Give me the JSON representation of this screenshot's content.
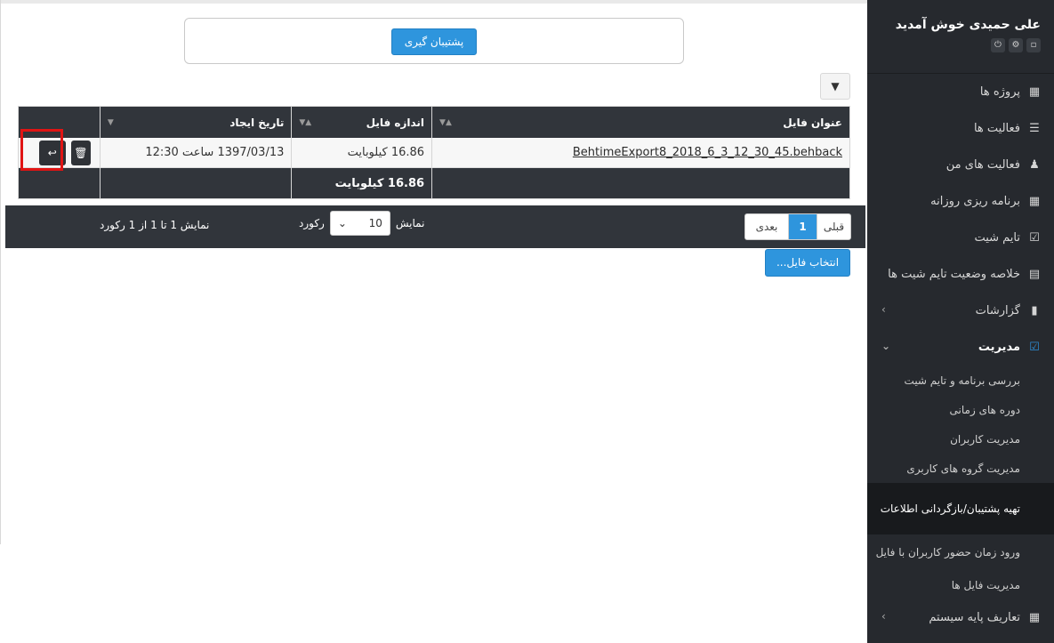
{
  "sidebar": {
    "user": "علی حمیدی خوش آمدید",
    "user_icons": [
      "lock-icon",
      "gear-icon",
      "power-icon"
    ],
    "items": [
      {
        "label": "پروژه ها",
        "icon": "cubes-icon"
      },
      {
        "label": "فعالیت ها",
        "icon": "tasks-icon"
      },
      {
        "label": "فعالیت های من",
        "icon": "user-icon"
      },
      {
        "label": "برنامه ریزی روزانه",
        "icon": "table-icon"
      },
      {
        "label": "تایم شیت",
        "icon": "calendar-check-icon"
      },
      {
        "label": "خلاصه وضعیت تایم شیت ها",
        "icon": "summary-icon"
      },
      {
        "label": "گزارشات",
        "icon": "file-icon"
      },
      {
        "label": "مدیریت",
        "icon": "check-square-icon"
      }
    ],
    "sub_items": [
      "بررسی برنامه و تایم شیت",
      "دوره های زمانی",
      "مدیریت کاربران",
      "مدیریت گروه های کاربری",
      "تهیه پشتیبان/بازگردانی اطلاعات",
      "ورود زمان حضور کاربران با فایل",
      "مدیریت فایل ها"
    ],
    "last_item": {
      "label": "تعاریف پایه سیستم",
      "icon": "grid-icon"
    }
  },
  "main": {
    "backup_button": "پشتیبان گیری",
    "filter_icon": "filter-icon",
    "table": {
      "headers": [
        "عنوان فایل",
        "اندازه فایل",
        "تاریخ ایجاد"
      ],
      "rows": [
        {
          "title": "BehtimeExport8_2018_6_3_12_30_45.behback",
          "size": "16.86 کیلوبایت",
          "date": "1397/03/13 ساعت 12:30"
        }
      ],
      "total_size": "16.86 کیلوبایت"
    },
    "pager": {
      "prev": "قبلی",
      "page": "1",
      "next": "بعدی",
      "show_label": "نمایش",
      "page_size": "10",
      "records_label": "رکورد",
      "info": "نمایش 1 تا 1 از 1 رکورد"
    },
    "choose_file_button": "انتخاب فایل..."
  }
}
